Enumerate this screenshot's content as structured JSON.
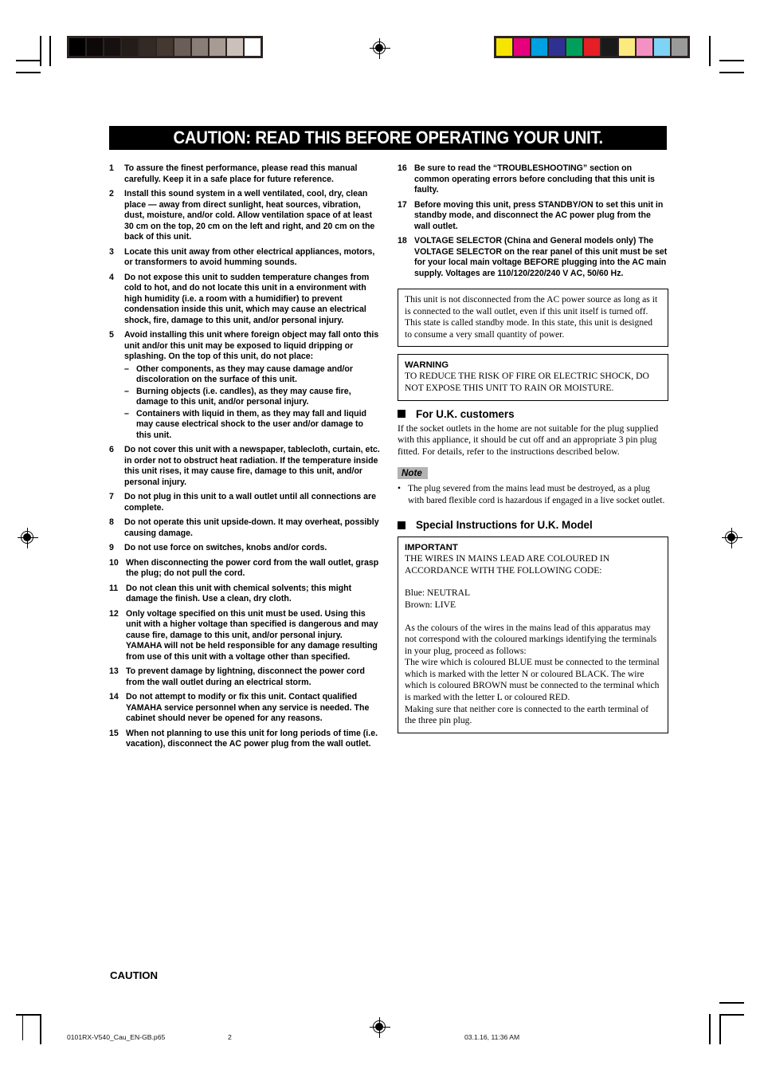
{
  "page": {
    "title_bar": "CAUTION: READ THIS BEFORE OPERATING YOUR UNIT.",
    "bottom_label": "CAUTION"
  },
  "left_column": {
    "items": [
      {
        "num": "1",
        "text": "To assure the finest performance, please read this manual carefully. Keep it in a safe place for future reference."
      },
      {
        "num": "2",
        "text": "Install this sound system in a well ventilated, cool, dry, clean place — away from direct sunlight, heat sources, vibration, dust, moisture, and/or cold. Allow ventilation space of at least 30 cm on the top, 20 cm on the left and right, and 20 cm on the back of this unit."
      },
      {
        "num": "3",
        "text": "Locate this unit away from other electrical appliances, motors, or transformers to avoid humming sounds."
      },
      {
        "num": "4",
        "text": "Do not expose this unit to sudden temperature changes from cold to hot, and do not locate this unit in a environment with high humidity (i.e. a room with a humidifier) to prevent condensation inside this unit, which may cause an electrical shock, fire, damage to this unit, and/or personal injury."
      },
      {
        "num": "5",
        "text": "Avoid installing this unit where foreign object may fall onto this unit and/or this unit may be exposed to liquid dripping or splashing. On the top of this unit, do not place:"
      },
      {
        "num": "6",
        "text": "Do not cover this unit with a newspaper, tablecloth, curtain, etc. in order not to obstruct heat radiation. If the temperature inside this unit rises, it may cause fire, damage to this unit, and/or personal injury."
      },
      {
        "num": "7",
        "text": "Do not plug in this unit to a wall outlet until all connections are complete."
      },
      {
        "num": "8",
        "text": "Do not operate this unit upside-down. It may overheat, possibly causing damage."
      },
      {
        "num": "9",
        "text": "Do not use force on switches, knobs and/or cords."
      },
      {
        "num": "10",
        "text": "When disconnecting the power cord from the wall outlet, grasp the plug; do not pull the cord."
      },
      {
        "num": "11",
        "text": "Do not clean this unit with chemical solvents; this might damage the finish. Use a clean, dry cloth."
      },
      {
        "num": "12",
        "text": "Only voltage specified on this unit must be used. Using this unit with a higher voltage than specified is dangerous and may cause fire, damage to this unit, and/or personal injury. YAMAHA will not be held responsible for any damage resulting from use of this unit with a voltage other than specified."
      },
      {
        "num": "13",
        "text": "To prevent damage by lightning, disconnect the power cord from the wall outlet during an electrical storm."
      },
      {
        "num": "14",
        "text": "Do not attempt to modify or fix this unit. Contact qualified YAMAHA service personnel when any service is needed. The cabinet should never be opened for any reasons."
      },
      {
        "num": "15",
        "text": "When not planning to use this unit for long periods of time (i.e. vacation), disconnect the AC power plug from the wall outlet."
      }
    ],
    "sub_items_5": [
      {
        "dash": "–",
        "text": "Other components, as they may cause damage and/or discoloration on the surface of this unit."
      },
      {
        "dash": "–",
        "text": "Burning objects (i.e. candles), as they may cause fire, damage to this unit, and/or personal injury."
      },
      {
        "dash": "–",
        "text": "Containers with liquid in them, as they may fall and liquid may cause electrical shock to the user and/or damage to this unit."
      }
    ]
  },
  "right_column": {
    "items": [
      {
        "num": "16",
        "text": "Be sure to read the “TROUBLESHOOTING” section on common operating errors before concluding that this unit is faulty."
      },
      {
        "num": "17",
        "text": "Before moving this unit, press STANDBY/ON to set this unit in standby mode, and disconnect the AC power plug from the wall outlet."
      },
      {
        "num": "18",
        "text": "VOLTAGE SELECTOR (China and General models only) The VOLTAGE SELECTOR on the rear panel of this unit must be set for your local main voltage BEFORE plugging into the AC main supply. Voltages are 110/120/220/240 V AC, 50/60 Hz."
      }
    ],
    "standby_box": "This unit is not disconnected from the AC power source as long as it is connected to the wall outlet, even if this unit itself is turned off. This state is called standby mode. In this state, this unit is designed to consume a very small quantity of power.",
    "warning_box": {
      "heading": "WARNING",
      "text": "TO REDUCE THE RISK OF FIRE OR ELECTRIC SHOCK, DO NOT EXPOSE THIS UNIT TO RAIN OR MOISTURE."
    },
    "uk_customers": {
      "heading": "For U.K. customers",
      "paragraph": "If the socket outlets in the home are not suitable for the plug supplied with this appliance, it should be cut off and an appropriate 3 pin plug fitted. For details, refer to the instructions described below.",
      "note_label": "Note",
      "note_bullet_marker": "•",
      "note_text": "The plug severed from the mains lead must be destroyed, as a plug with bared flexible cord is hazardous if engaged in a live socket outlet."
    },
    "uk_model": {
      "heading": "Special Instructions for U.K. Model",
      "important_heading": "IMPORTANT",
      "important_line1": "THE WIRES IN MAINS LEAD ARE COLOURED IN ACCORDANCE WITH THE FOLLOWING CODE:",
      "code_neutral": "Blue: NEUTRAL",
      "code_live": "Brown: LIVE",
      "body_para1": "As the colours of the wires in the mains lead of this apparatus may not correspond with the coloured markings identifying the terminals in your plug, proceed as follows:",
      "body_para2": "The wire which is coloured BLUE must be connected to the terminal which is marked with the letter N or coloured BLACK. The wire which is coloured BROWN must be connected to the terminal which is marked with the letter L or coloured RED.",
      "body_para3": "Making sure that neither core is connected to the earth terminal of the three pin plug."
    }
  },
  "footer": {
    "filename": "0101RX-V540_Cau_EN-GB.p65",
    "page_number": "2",
    "timestamp": "03.1.16, 11:36 AM"
  },
  "calibration": {
    "gray_swatches": [
      "#000000",
      "#0d0909",
      "#161010",
      "#241c19",
      "#332a25",
      "#443831",
      "#6b5e58",
      "#897d77",
      "#a79b94",
      "#cbc0ba",
      "#ffffff"
    ],
    "color_swatches": [
      "#f5e500",
      "#e6007e",
      "#00a0e3",
      "#2e3192",
      "#00a05a",
      "#e61e25",
      "#1a1a1a",
      "#faea80",
      "#f590c3",
      "#7fd3f5",
      "#9a9a9a"
    ]
  }
}
